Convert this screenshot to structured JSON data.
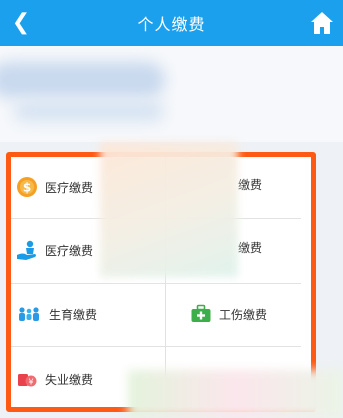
{
  "header": {
    "back_icon": "chevron-left-icon",
    "title": "个人缴费",
    "home_icon": "home-icon",
    "bg_color": "#1aa0ec"
  },
  "grid": {
    "highlight_color": "#ff5a14",
    "items": [
      {
        "label": "医疗缴费",
        "icon": "coin-dollar-icon"
      },
      {
        "label": "缴费",
        "icon": ""
      },
      {
        "label": "医疗缴费",
        "icon": "hand-person-icon"
      },
      {
        "label": "缴费",
        "icon": ""
      },
      {
        "label": "生育缴费",
        "icon": "family-icon"
      },
      {
        "label": "工伤缴费",
        "icon": "briefcase-plus-icon"
      },
      {
        "label": "失业缴费",
        "icon": "wallet-cash-icon"
      }
    ]
  }
}
